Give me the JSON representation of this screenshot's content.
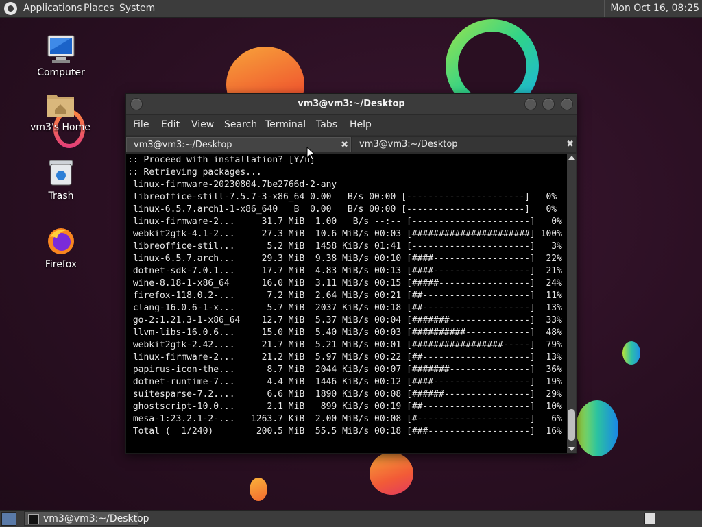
{
  "top_panel": {
    "menus": [
      "Applications",
      "Places",
      "System"
    ],
    "clock": "Mon Oct 16, 08:25"
  },
  "desktop_icons": [
    {
      "label": "Computer",
      "icon": "computer-icon"
    },
    {
      "label": "vm3's Home",
      "icon": "home-folder-icon"
    },
    {
      "label": "Trash",
      "icon": "trash-icon"
    },
    {
      "label": "Firefox",
      "icon": "firefox-icon"
    }
  ],
  "terminal": {
    "title": "vm3@vm3:~/Desktop",
    "menu": [
      "File",
      "Edit",
      "View",
      "Search",
      "Terminal",
      "Tabs",
      "Help"
    ],
    "tabs": [
      {
        "label": "vm3@vm3:~/Desktop",
        "active": true
      },
      {
        "label": "vm3@vm3:~/Desktop",
        "active": false
      }
    ],
    "lines": [
      ":: Proceed with installation? [Y/n]",
      ":: Retrieving packages...",
      " linux-firmware-20230804.7be2766d-2-any",
      " libreoffice-still-7.5.7-3-x86_64 0.00   B/s 00:00 [----------------------]   0%",
      " linux-6.5.7.arch1-1-x86_640   B  0.00   B/s 00:00 [----------------------]   0%",
      " linux-firmware-2...     31.7 MiB  1.00   B/s --:-- [----------------------]   0%",
      " webkit2gtk-4.1-2...     27.3 MiB  10.6 MiB/s 00:03 [######################] 100%",
      " libreoffice-stil...      5.2 MiB  1458 KiB/s 01:41 [----------------------]   3%",
      " linux-6.5.7.arch...     29.3 MiB  9.38 MiB/s 00:10 [####------------------]  22%",
      " dotnet-sdk-7.0.1...     17.7 MiB  4.83 MiB/s 00:13 [####------------------]  21%",
      " wine-8.18-1-x86_64      16.0 MiB  3.11 MiB/s 00:15 [#####-----------------]  24%",
      " firefox-118.0.2-...      7.2 MiB  2.64 MiB/s 00:21 [##--------------------]  11%",
      " clang-16.0.6-1-x...      5.7 MiB  2037 KiB/s 00:18 [##--------------------]  13%",
      " go-2:1.21.3-1-x86_64    12.7 MiB  5.37 MiB/s 00:04 [#######---------------]  33%",
      " llvm-libs-16.0.6...     15.0 MiB  5.40 MiB/s 00:03 [##########------------]  48%",
      " webkit2gtk-2.42....     21.7 MiB  5.21 MiB/s 00:01 [#################-----]  79%",
      " linux-firmware-2...     21.2 MiB  5.97 MiB/s 00:22 [##--------------------]  13%",
      " papirus-icon-the...      8.7 MiB  2044 KiB/s 00:07 [#######---------------]  36%",
      " dotnet-runtime-7...      4.4 MiB  1446 KiB/s 00:12 [####------------------]  19%",
      " suitesparse-7.2....      6.6 MiB  1890 KiB/s 00:08 [######----------------]  29%",
      " ghostscript-10.0...      2.1 MiB   899 KiB/s 00:19 [##--------------------]  10%",
      " mesa-1:23.2.1-2-...   1263.7 KiB  2.00 MiB/s 00:08 [#---------------------]   6%",
      " Total (  1/240)        200.5 MiB  55.5 MiB/s 00:18 [###-------------------]  16%"
    ]
  },
  "taskbar": {
    "task_label": "vm3@vm3:~/Desktop"
  }
}
